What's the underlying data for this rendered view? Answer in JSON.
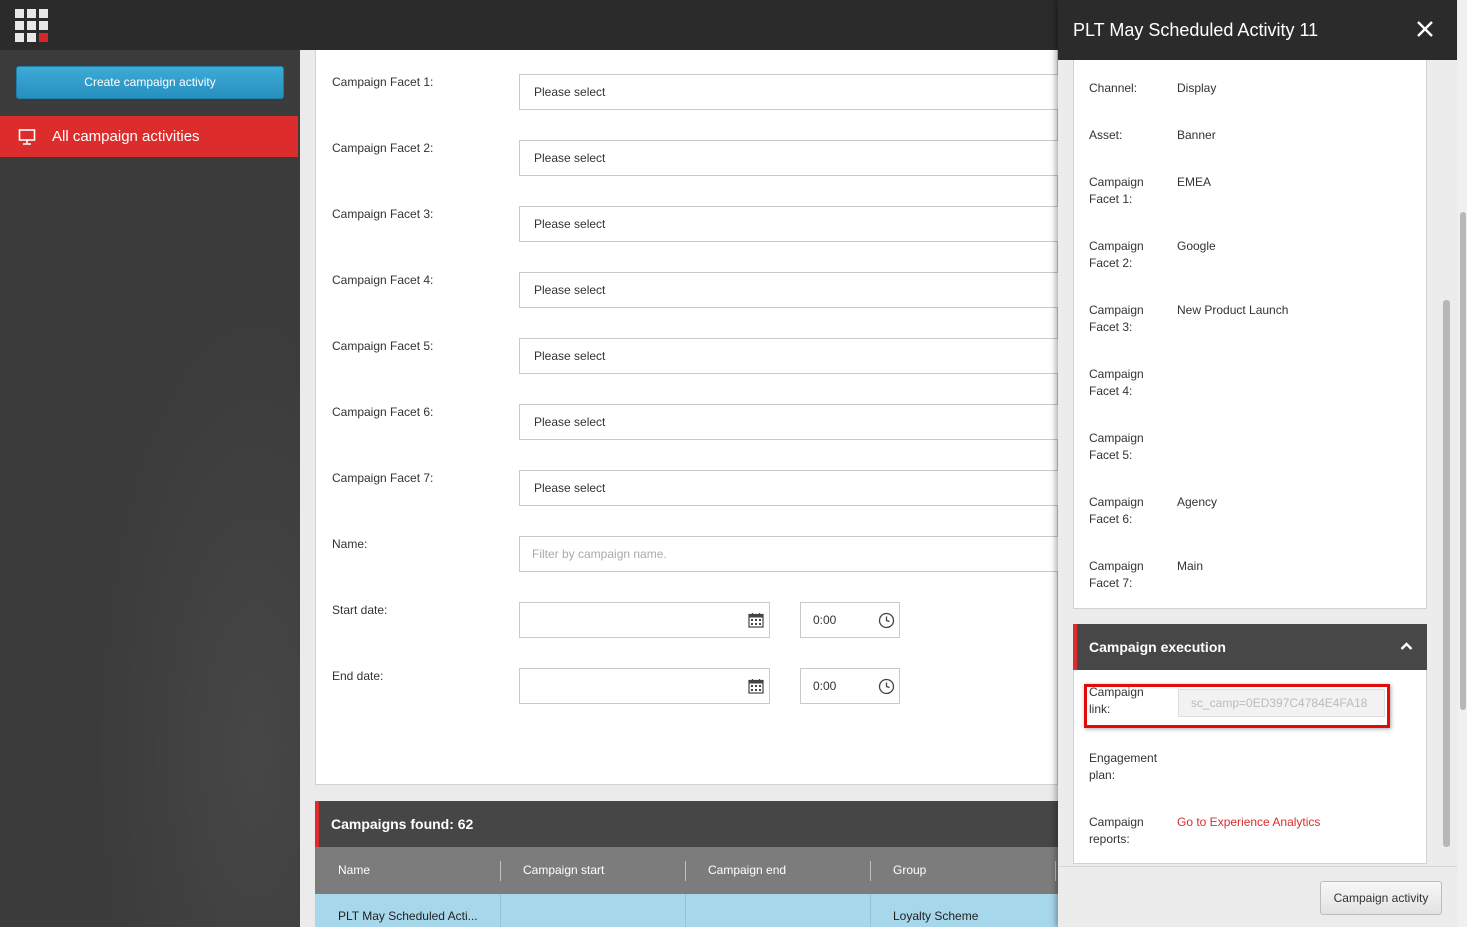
{
  "sidebar": {
    "create_button": "Create campaign activity",
    "active_item": "All campaign activities"
  },
  "filters": {
    "facets": [
      {
        "label": "Campaign Facet 1:",
        "value": "Please select"
      },
      {
        "label": "Campaign Facet 2:",
        "value": "Please select"
      },
      {
        "label": "Campaign Facet 3:",
        "value": "Please select"
      },
      {
        "label": "Campaign Facet 4:",
        "value": "Please select"
      },
      {
        "label": "Campaign Facet 5:",
        "value": "Please select"
      },
      {
        "label": "Campaign Facet 6:",
        "value": "Please select"
      },
      {
        "label": "Campaign Facet 7:",
        "value": "Please select"
      }
    ],
    "name_label": "Name:",
    "name_placeholder": "Filter by campaign name.",
    "start_label": "Start date:",
    "start_time": "0:00",
    "end_label": "End date:",
    "end_time": "0:00"
  },
  "results": {
    "header": "Campaigns found: 62",
    "columns": [
      "Name",
      "Campaign start",
      "Campaign end",
      "Group"
    ],
    "rows": [
      {
        "name": "PLT May Scheduled Acti...",
        "start": "",
        "end": "",
        "group": "Loyalty Scheme"
      }
    ]
  },
  "detail": {
    "title": "PLT May Scheduled Activity 11",
    "fields": [
      {
        "label": "Channel:",
        "value": "Display"
      },
      {
        "label": "Asset:",
        "value": "Banner"
      },
      {
        "label": "Campaign Facet 1:",
        "value": "EMEA"
      },
      {
        "label": "Campaign Facet 2:",
        "value": "Google"
      },
      {
        "label": "Campaign Facet 3:",
        "value": "New Product Launch"
      },
      {
        "label": "Campaign Facet 4:",
        "value": ""
      },
      {
        "label": "Campaign Facet 5:",
        "value": ""
      },
      {
        "label": "Campaign Facet 6:",
        "value": "Agency"
      },
      {
        "label": "Campaign Facet 7:",
        "value": "Main"
      }
    ],
    "execution": {
      "header": "Campaign execution",
      "link_label": "Campaign link:",
      "link_value": "sc_camp=0ED397C4784E4FA18",
      "engagement_label": "Engagement plan:",
      "reports_label": "Campaign reports:",
      "reports_link": "Go to Experience Analytics"
    },
    "footer_button": "Campaign activity"
  },
  "colors": {
    "accent_red": "#dc2c2c",
    "button_blue": "#2690bf",
    "row_selected": "#a7d7ea"
  }
}
